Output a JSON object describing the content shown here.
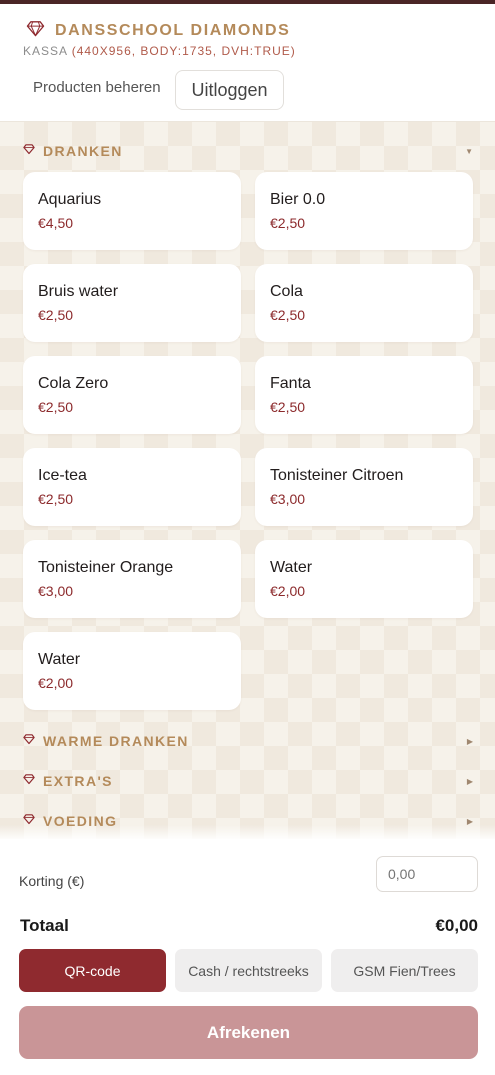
{
  "app": {
    "title": "DANSSCHOOL DIAMONDS",
    "subtitle_prefix": "KASSA",
    "subtitle_detail": "(440X956, BODY:1735, DVH:TRUE)",
    "manage_label": "Producten beheren",
    "logout_label": "Uitloggen"
  },
  "categories": [
    {
      "label": "DRANKEN",
      "expanded": true,
      "chevron": "▼",
      "products": [
        {
          "name": "Aquarius",
          "price": "€4,50"
        },
        {
          "name": "Bier 0.0",
          "price": "€2,50"
        },
        {
          "name": "Bruis water",
          "price": "€2,50"
        },
        {
          "name": "Cola",
          "price": "€2,50"
        },
        {
          "name": "Cola Zero",
          "price": "€2,50"
        },
        {
          "name": "Fanta",
          "price": "€2,50"
        },
        {
          "name": "Ice-tea",
          "price": "€2,50"
        },
        {
          "name": "Tonisteiner Citroen",
          "price": "€3,00"
        },
        {
          "name": "Tonisteiner Orange",
          "price": "€3,00"
        },
        {
          "name": "Water",
          "price": "€2,00"
        },
        {
          "name": "Water",
          "price": "€2,00"
        }
      ]
    },
    {
      "label": "WARME DRANKEN",
      "expanded": false,
      "chevron": "▶"
    },
    {
      "label": "EXTRA'S",
      "expanded": false,
      "chevron": "▶"
    },
    {
      "label": "VOEDING",
      "expanded": false,
      "chevron": "▶"
    }
  ],
  "checkout": {
    "discount_label": "Korting (€)",
    "discount_placeholder": "0,00",
    "total_label": "Totaal",
    "total_value": "€0,00",
    "payment_methods": [
      {
        "label": "QR-code",
        "active": true
      },
      {
        "label": "Cash / rechtstreeks",
        "active": false
      },
      {
        "label": "GSM Fien/Trees",
        "active": false
      }
    ],
    "checkout_label": "Afrekenen"
  },
  "colors": {
    "brand": "#b48a5a",
    "accent": "#8f2a2f",
    "price": "#8c2a2c",
    "checkout_disabled": "#c99597"
  },
  "icons": {
    "brand": "diamond-icon",
    "category": "diamond-icon"
  }
}
